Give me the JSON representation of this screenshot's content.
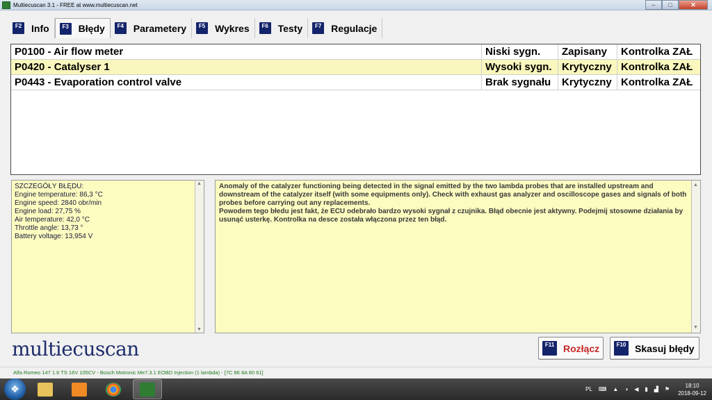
{
  "window": {
    "title": "Multiecuscan 3.1 - FREE at www.multiecuscan.net",
    "controls": {
      "minimize": "–",
      "maximize": "□",
      "close": "✕"
    }
  },
  "tabs": [
    {
      "key": "F2",
      "label": "Info",
      "active": false
    },
    {
      "key": "F3",
      "label": "Błędy",
      "active": true
    },
    {
      "key": "F4",
      "label": "Parametery",
      "active": false
    },
    {
      "key": "F5",
      "label": "Wykres",
      "active": false
    },
    {
      "key": "F6",
      "label": "Testy",
      "active": false
    },
    {
      "key": "F7",
      "label": "Regulacje",
      "active": false
    }
  ],
  "errors": [
    {
      "code": "P0100 - Air flow meter",
      "signal": "Niski sygn.",
      "status": "Zapisany",
      "lamp": "Kontrolka ZAŁ",
      "selected": false
    },
    {
      "code": "P0420 - Catalyser 1",
      "signal": "Wysoki sygn.",
      "status": "Krytyczny",
      "lamp": "Kontrolka ZAŁ",
      "selected": true
    },
    {
      "code": "P0443 - Evaporation control valve",
      "signal": "Brak sygnału",
      "status": "Krytyczny",
      "lamp": "Kontrolka ZAŁ",
      "selected": false
    }
  ],
  "details": {
    "lines": [
      "SZCZEGÓŁY BŁĘDU:",
      "Engine temperature: 86,3 °C",
      "Engine speed: 2840 obr/min",
      "Engine load: 27,75 %",
      "Air temperature: 42,0 °C",
      "Throttle angle: 13,73 °",
      "Battery voltage: 13,954 V"
    ]
  },
  "description": {
    "paragraph1": "Anomaly of the catalyzer functioning being detected in the signal emitted by the two lambda probes that are installed upstream and downstream of the catalyzer itself (with some equipments only). Check with exhaust gas analyzer and oscilloscope gases and signals of both probes before carrying out any replacements.",
    "paragraph2": "Powodem tego błedu jest fakt, że ECU odebrało bardzo wysoki sygnał z czujnika. Błąd obecnie jest aktywny. Podejmij stosowne działania by usunąć usterkę. Kontrolka na desce została włączona przez ten błąd."
  },
  "logo": "multiecuscan",
  "buttons": {
    "disconnect": {
      "key": "F11",
      "label": "Rozłącz"
    },
    "clear": {
      "key": "F10",
      "label": "Skasuj błędy"
    }
  },
  "status_line": "Alfa Romeo 147 1.6 TS 16V 105CV - Bosch Motronic Me7.3.1 EOBD Injection (1 lambda) - [7C 86 8A 80 61]",
  "taskbar": {
    "apps": [
      {
        "icon": "explorer-icon",
        "color": "#e8c25a",
        "active": false
      },
      {
        "icon": "media-player-icon",
        "color": "#f08a24",
        "active": false
      },
      {
        "icon": "chrome-icon",
        "color": "#3c9a3c",
        "active": false
      },
      {
        "icon": "multiecuscan-icon",
        "color": "#2e7d32",
        "active": true
      }
    ],
    "language": "PL",
    "time": "18:10",
    "date": "2018-09-12"
  },
  "colors": {
    "selected_row": "#f9f7bd",
    "panel_bg": "#fdfcc0",
    "fkey_bg": "#14246b",
    "disconnect_text": "#c62828",
    "status_green": "#1f7a1f"
  }
}
